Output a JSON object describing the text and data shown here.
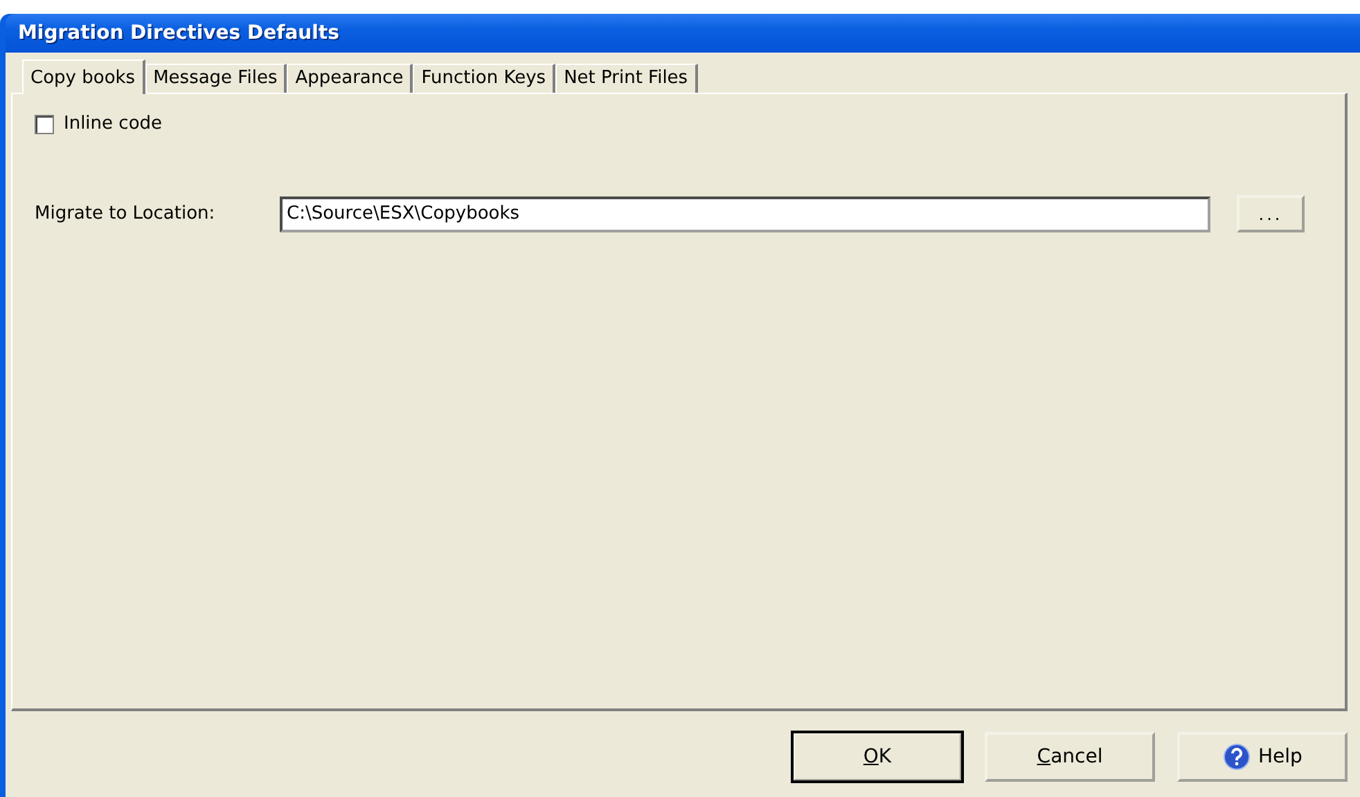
{
  "window": {
    "title": "Migration Directives Defaults"
  },
  "tabs": [
    {
      "label": "Copy books",
      "selected": true
    },
    {
      "label": "Message Files",
      "selected": false
    },
    {
      "label": "Appearance",
      "selected": false
    },
    {
      "label": "Function Keys",
      "selected": false
    },
    {
      "label": "Net Print Files",
      "selected": false
    }
  ],
  "inline_code": {
    "label": "Inline code",
    "checked": false
  },
  "location": {
    "label": "Migrate to Location:",
    "value": "C:\\Source\\ESX\\Copybooks",
    "browse": "..."
  },
  "buttons": [
    {
      "access_key": "O",
      "label": "K",
      "kind": "default"
    },
    {
      "access_key": "C",
      "label": "ancel",
      "kind": "plain"
    },
    {
      "label": "Help",
      "kind": "help"
    }
  ]
}
